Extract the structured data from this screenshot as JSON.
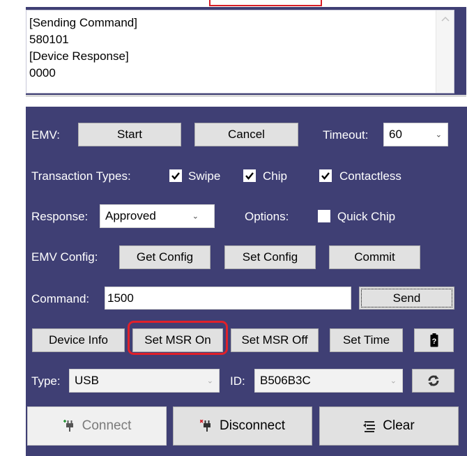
{
  "output": {
    "lines": [
      "[Sending Command]",
      "580101",
      "[Device Response]",
      "0000"
    ]
  },
  "emv": {
    "label": "EMV:",
    "start_label": "Start",
    "cancel_label": "Cancel",
    "timeout_label": "Timeout:",
    "timeout_value": "60"
  },
  "transaction_types": {
    "label": "Transaction Types:",
    "swipe": {
      "label": "Swipe",
      "checked": true
    },
    "chip": {
      "label": "Chip",
      "checked": true
    },
    "contactless": {
      "label": "Contactless",
      "checked": true
    }
  },
  "response": {
    "label": "Response:",
    "value": "Approved",
    "options_label": "Options:",
    "quick_chip": {
      "label": "Quick Chip",
      "checked": false
    }
  },
  "emv_config": {
    "label": "EMV Config:",
    "get_label": "Get Config",
    "set_label": "Set Config",
    "commit_label": "Commit"
  },
  "command": {
    "label": "Command:",
    "value": "1500",
    "send_label": "Send"
  },
  "actions": {
    "device_info": "Device Info",
    "set_msr_on": "Set MSR On",
    "set_msr_off": "Set MSR Off",
    "set_time": "Set Time"
  },
  "connection": {
    "type_label": "Type:",
    "type_value": "USB",
    "id_label": "ID:",
    "id_value": "B506B3C"
  },
  "bottom": {
    "connect_label": "Connect",
    "disconnect_label": "Disconnect",
    "clear_label": "Clear"
  },
  "colors": {
    "panel": "#3f3f74",
    "highlight": "#e0202a"
  }
}
